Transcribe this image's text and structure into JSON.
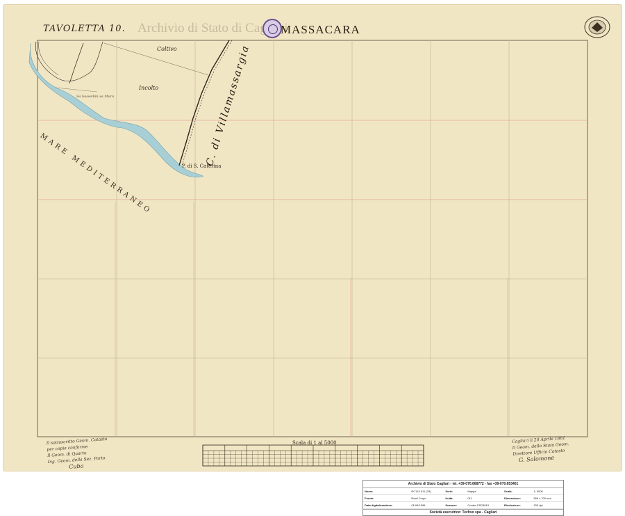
{
  "map": {
    "title": "TAVOLETTA 10.",
    "name": "MASSACARA",
    "watermark": "Archivio di Stato di Cagliari",
    "labels": {
      "coltivo": "Coltivo",
      "incolto": "Incolto",
      "small_note": "Sa bassedda sa Mura",
      "punta": "P. di S. Caterina",
      "sea": "MARE MEDITERRANEO",
      "canale": "C. di Villamassargia"
    },
    "scale_title": "Scala di 1 al 5000",
    "note_left": [
      "Il sottoscritto Geom. Catasto",
      "per copia conforme",
      "Il Geom. di Quartu",
      "Ing. Geom. della Sez. Porto",
      "Cuba"
    ],
    "note_right": [
      "Cagliari li 20 Aprile 1861",
      "Il Geom. dello Stato Geom.",
      "Direttore Ufficio Catasto",
      "G. Salomone"
    ]
  },
  "info": {
    "header": "Archivio di Stato Cagliari - tel. +39-070.668772 - fax +39-070.653401",
    "rows": [
      {
        "k1": "Nome:",
        "v1": "RC113-011 (T8)",
        "k2": "Serie:",
        "v2": "Mappa",
        "k3": "Scala:",
        "v3": "1: 5000"
      },
      {
        "k1": "Fondo:",
        "v1": "Reali Corpo",
        "k2": "Unità:",
        "v2": "011",
        "k3": "Dimensione:",
        "v3": "590 x 700 mm"
      },
      {
        "k1": "Data digitalizzazione:",
        "v1": "01/04/1999",
        "k2": "Scanner:",
        "v2": "Contex FSC8010",
        "k3": "Risoluzione:",
        "v3": "200 dpi"
      }
    ],
    "footer": "Società esecutrice: Techso spa - Cagliari"
  },
  "colors": {
    "paper": "#f1e6c4",
    "sea": "#a9cfd6",
    "grid_red": "#e2a49a",
    "grid_gray": "#cdbf9f",
    "stamp": "#6b4f8f"
  }
}
